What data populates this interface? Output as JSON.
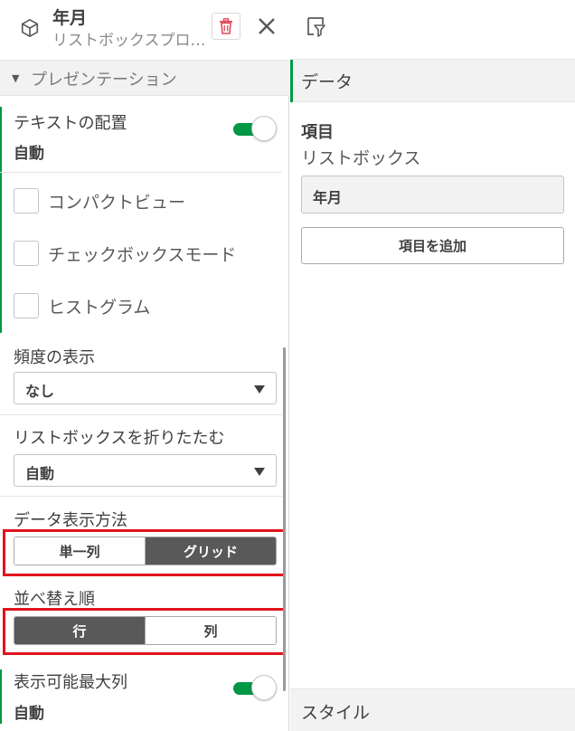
{
  "header": {
    "title": "年月",
    "subtitle": "リストボックスプロパティ",
    "icons": {
      "object": "cube-icon",
      "delete": "trash-icon",
      "close": "close-icon"
    }
  },
  "presentation": {
    "section_label": "プレゼンテーション",
    "text_alignment": {
      "label": "テキストの配置",
      "value": "自動",
      "toggle_on": true
    },
    "checkboxes": [
      {
        "label": "コンパクトビュー",
        "checked": false
      },
      {
        "label": "チェックボックスモード",
        "checked": false
      },
      {
        "label": "ヒストグラム",
        "checked": false
      }
    ],
    "frequency": {
      "label": "頻度の表示",
      "value": "なし"
    },
    "collapse": {
      "label": "リストボックスを折りたたむ",
      "value": "自動"
    },
    "display_mode": {
      "label": "データ表示方法",
      "options": [
        "単一列",
        "グリッド"
      ],
      "selected": "グリッド"
    },
    "sort_order": {
      "label": "並べ替え順",
      "options": [
        "行",
        "列"
      ],
      "selected": "行"
    },
    "max_columns": {
      "label": "表示可能最大列",
      "value": "自動",
      "toggle_on": true
    }
  },
  "right_panel": {
    "filter_icon": "filter-icon",
    "data_section": "データ",
    "field_heading": "項目",
    "field_subheading": "リストボックス",
    "field_value": "年月",
    "add_field_button": "項目を追加",
    "style_section": "スタイル"
  },
  "colors": {
    "accent_green": "#009845",
    "highlight_red": "#e0141c",
    "trash_red": "#e04a5a",
    "segment_selected": "#595959"
  }
}
